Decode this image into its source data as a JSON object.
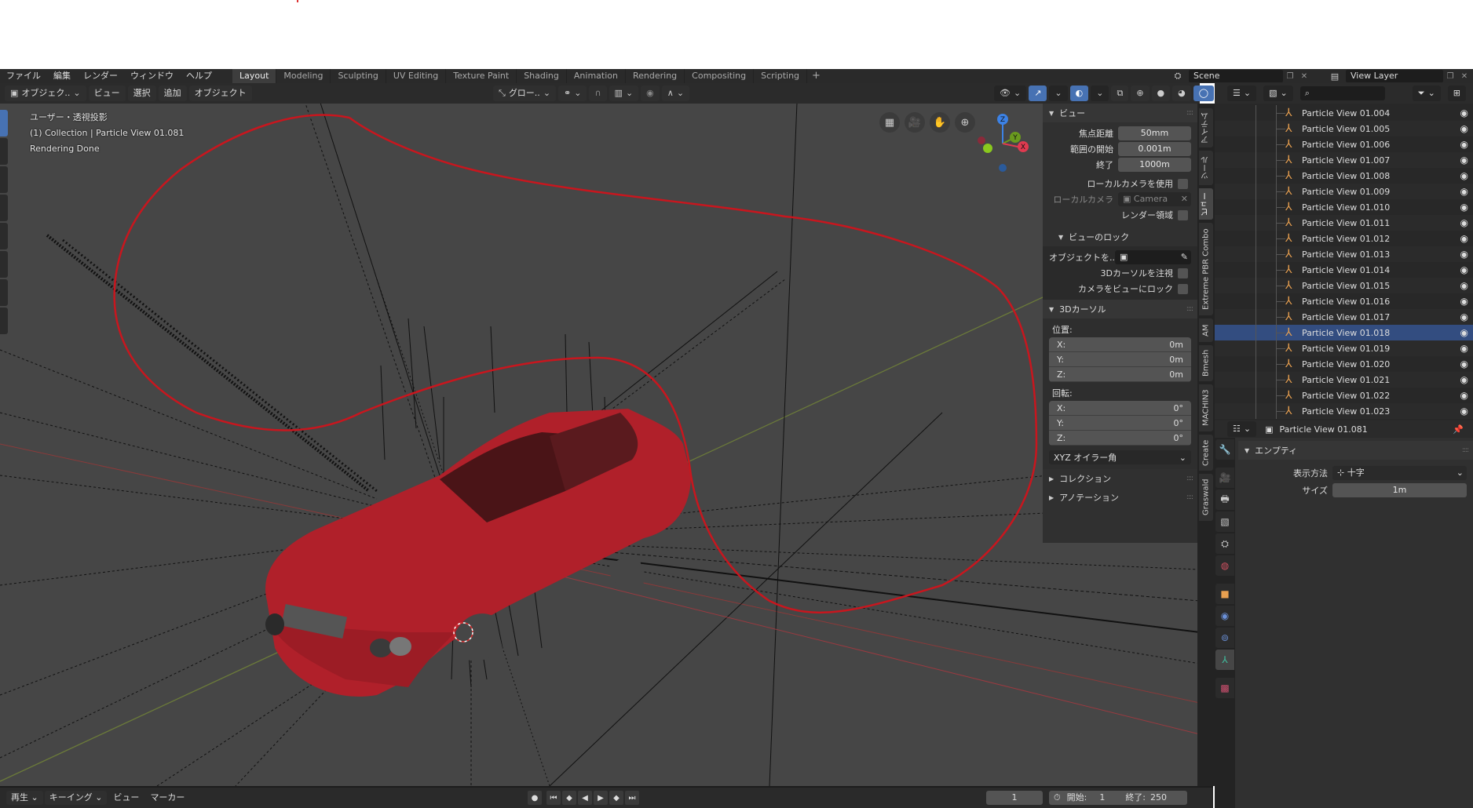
{
  "menu": {
    "items": [
      "ファイル",
      "編集",
      "レンダー",
      "ウィンドウ",
      "ヘルプ"
    ],
    "workspaces": [
      "Layout",
      "Modeling",
      "Sculpting",
      "UV Editing",
      "Texture Paint",
      "Shading",
      "Animation",
      "Rendering",
      "Compositing",
      "Scripting"
    ],
    "active_workspace": "Layout",
    "add_tab": "+",
    "scene": "Scene",
    "view_layer": "View Layer"
  },
  "viewport_header": {
    "mode": "オブジェク..",
    "menus": [
      "ビュー",
      "選択",
      "追加",
      "オブジェクト"
    ],
    "transform_orientation": "グロー..",
    "icons": {
      "orientation": "transform-axes-icon",
      "pivot": "link-icon",
      "snap": "magnet-icon",
      "snap_target": "snap-increment-icon",
      "proportional": "proportional-edit-icon",
      "falloff": "falloff-curve-icon",
      "visibility": "eye-cursor-icon",
      "gizmo": "gizmo-arrow-icon",
      "overlay": "overlay-icon",
      "xray": "xray-icon",
      "wireframe": "wireframe-shading-icon",
      "solid": "solid-shading-icon",
      "material": "material-shading-icon",
      "rendered": "rendered-shading-icon",
      "pause": "pause-icon"
    }
  },
  "viewport_info": {
    "projection": "ユーザー・透視投影",
    "collection": "(1) Collection | Particle View 01.081",
    "status": "Rendering Done"
  },
  "navigation": [
    "grid-toggle-icon",
    "camera-view-icon",
    "pan-hand-icon",
    "zoom-magnifier-icon"
  ],
  "gizmo": {
    "z": "Z",
    "y": "Y",
    "x": "X"
  },
  "npanel": {
    "view": {
      "title": "ビュー",
      "focal_length_label": "焦点距離",
      "focal_length": "50mm",
      "clip_start_label": "範囲の開始",
      "clip_start": "0.001m",
      "clip_end_label": "終了",
      "clip_end": "1000m",
      "use_local_camera": "ローカルカメラを使用",
      "local_camera_label": "ローカルカメラ",
      "local_camera": "Camera",
      "render_region": "レンダー領域"
    },
    "view_lock": {
      "title": "ビューのロック",
      "object_label": "オブジェクトを..",
      "lock_to_cursor": "3Dカーソルを注視",
      "lock_camera": "カメラをビューにロック"
    },
    "cursor": {
      "title": "3Dカーソル",
      "location_label": "位置:",
      "location": [
        {
          "axis": "X:",
          "value": "0m"
        },
        {
          "axis": "Y:",
          "value": "0m"
        },
        {
          "axis": "Z:",
          "value": "0m"
        }
      ],
      "rotation_label": "回転:",
      "rotation": [
        {
          "axis": "X:",
          "value": "0°"
        },
        {
          "axis": "Y:",
          "value": "0°"
        },
        {
          "axis": "Z:",
          "value": "0°"
        }
      ],
      "rotation_mode": "XYZ オイラー角"
    },
    "collection": {
      "title": "コレクション"
    },
    "annotation": {
      "title": "アノテーション"
    }
  },
  "side_tabs": [
    "アイテム",
    "ツール",
    "ビュー",
    "Extreme PBR Combo",
    "AM",
    "Bmesh",
    "MACHIN3",
    "Create",
    "Graswald"
  ],
  "active_side_tab": "ビュー",
  "outliner": {
    "items": [
      {
        "name": "Particle View 01.004",
        "selected": false
      },
      {
        "name": "Particle View 01.005",
        "selected": false
      },
      {
        "name": "Particle View 01.006",
        "selected": false
      },
      {
        "name": "Particle View 01.007",
        "selected": false
      },
      {
        "name": "Particle View 01.008",
        "selected": false
      },
      {
        "name": "Particle View 01.009",
        "selected": false
      },
      {
        "name": "Particle View 01.010",
        "selected": false
      },
      {
        "name": "Particle View 01.011",
        "selected": false
      },
      {
        "name": "Particle View 01.012",
        "selected": false
      },
      {
        "name": "Particle View 01.013",
        "selected": false
      },
      {
        "name": "Particle View 01.014",
        "selected": false
      },
      {
        "name": "Particle View 01.015",
        "selected": false
      },
      {
        "name": "Particle View 01.016",
        "selected": false
      },
      {
        "name": "Particle View 01.017",
        "selected": false
      },
      {
        "name": "Particle View 01.018",
        "selected": true
      },
      {
        "name": "Particle View 01.019",
        "selected": false
      },
      {
        "name": "Particle View 01.020",
        "selected": false
      },
      {
        "name": "Particle View 01.021",
        "selected": false
      },
      {
        "name": "Particle View 01.022",
        "selected": false
      },
      {
        "name": "Particle View 01.023",
        "selected": false
      }
    ]
  },
  "properties": {
    "object_name": "Particle View 01.081",
    "section": "エンプティ",
    "display_label": "表示方法",
    "display_value": "十字",
    "size_label": "サイズ",
    "size_value": "1m",
    "tabs": [
      "tool-icon",
      "render-icon",
      "output-icon",
      "view-layer-icon",
      "scene-icon",
      "world-icon",
      "object-icon",
      "physics-icon",
      "constraints-icon",
      "object-data-empty-icon",
      "texture-icon"
    ]
  },
  "timeline": {
    "playback": "再生",
    "keying": "キーイング",
    "view": "ビュー",
    "marker": "マーカー",
    "current_frame": "1",
    "start_label": "開始:",
    "start": "1",
    "end_label": "終了:",
    "end": "250"
  },
  "colors": {
    "accent_blue": "#4772b3",
    "selection": "#334d80",
    "annotation_red": "#c8161e",
    "car_red": "#b0202a"
  }
}
